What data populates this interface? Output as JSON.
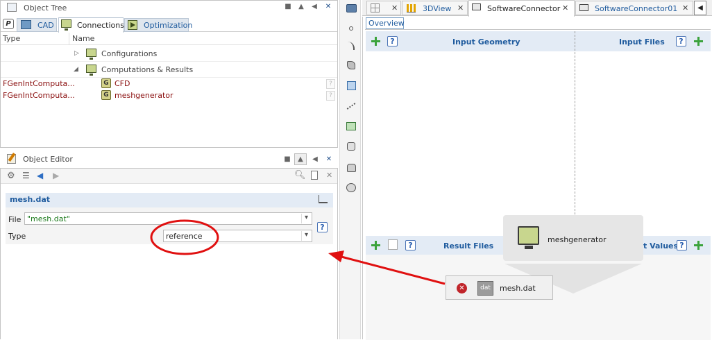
{
  "object_tree": {
    "title": "Object Tree",
    "tabs": {
      "p_label": "P",
      "cad": "CAD",
      "connections": "Connections",
      "optimization": "Optimization"
    },
    "columns": {
      "type": "Type",
      "name": "Name"
    },
    "nodes": {
      "configurations": "Configurations",
      "computations": "Computations & Results",
      "cfd_type": "FGenIntComputa...",
      "cfd_name": "CFD",
      "mesh_type": "FGenIntComputa...",
      "mesh_name": "meshgenerator",
      "g_letter": "G",
      "q_mark": "?"
    }
  },
  "object_editor": {
    "title": "Object Editor",
    "object_name": "mesh.dat",
    "file_label": "File",
    "file_value": "\"mesh.dat\"",
    "type_label": "Type",
    "type_value": "reference",
    "help": "?",
    "dropdown_arrow": "▾"
  },
  "editor_tabs": {
    "3dview": "3DView",
    "software_connector": "SoftwareConnector",
    "software_connector01": "SoftwareConnector01",
    "close": "✕"
  },
  "canvas": {
    "overview_tab": "Overview",
    "input_geometry": "Input Geometry",
    "input_files": "Input Files",
    "result_files": "Result Files",
    "values_partial": "t Values",
    "help": "?",
    "popup_label": "meshgenerator",
    "file_item": "mesh.dat",
    "dat_badge": "dat"
  },
  "colors": {
    "highlight_ellipse": "#e01010",
    "arrow": "#e01010",
    "header_blue": "#1f5b9e"
  }
}
